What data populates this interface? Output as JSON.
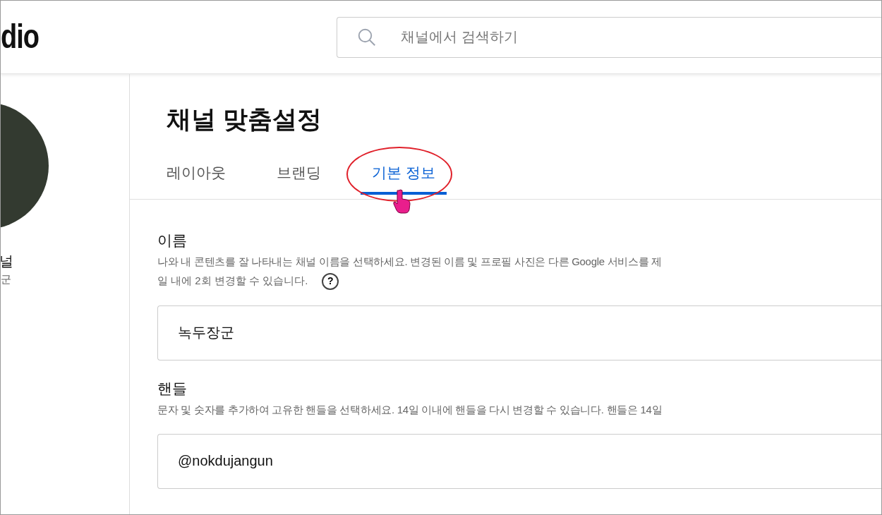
{
  "header": {
    "logo": "dio",
    "search": {
      "placeholder": "채널에서 검색하기"
    }
  },
  "sidebar": {
    "channel_name": "널",
    "channel_sub": "군"
  },
  "page": {
    "title": "채널 맞춤설정"
  },
  "tabs": [
    {
      "label": "레이아웃",
      "selected": false
    },
    {
      "label": "브랜딩",
      "selected": false
    },
    {
      "label": "기본 정보",
      "selected": true,
      "annotated": true
    }
  ],
  "sections": [
    {
      "label": "이름",
      "description": "나와 내 콘텐츠를 잘 나타내는 채널 이름을 선택하세요. 변경된 이름 및 프로필 사진은 다른 Google 서비스를 제",
      "description_2": "일 내에 2회 변경할 수 있습니다.",
      "help": "?",
      "value": "녹두장군"
    },
    {
      "label": "핸들",
      "description": "문자 및 숫자를 추가하여 고유한 핸들을 선택하세요. 14일 이내에 핸들을 다시 변경할 수 있습니다. 핸들은 14일",
      "value": "@nokdujangun"
    }
  ]
}
